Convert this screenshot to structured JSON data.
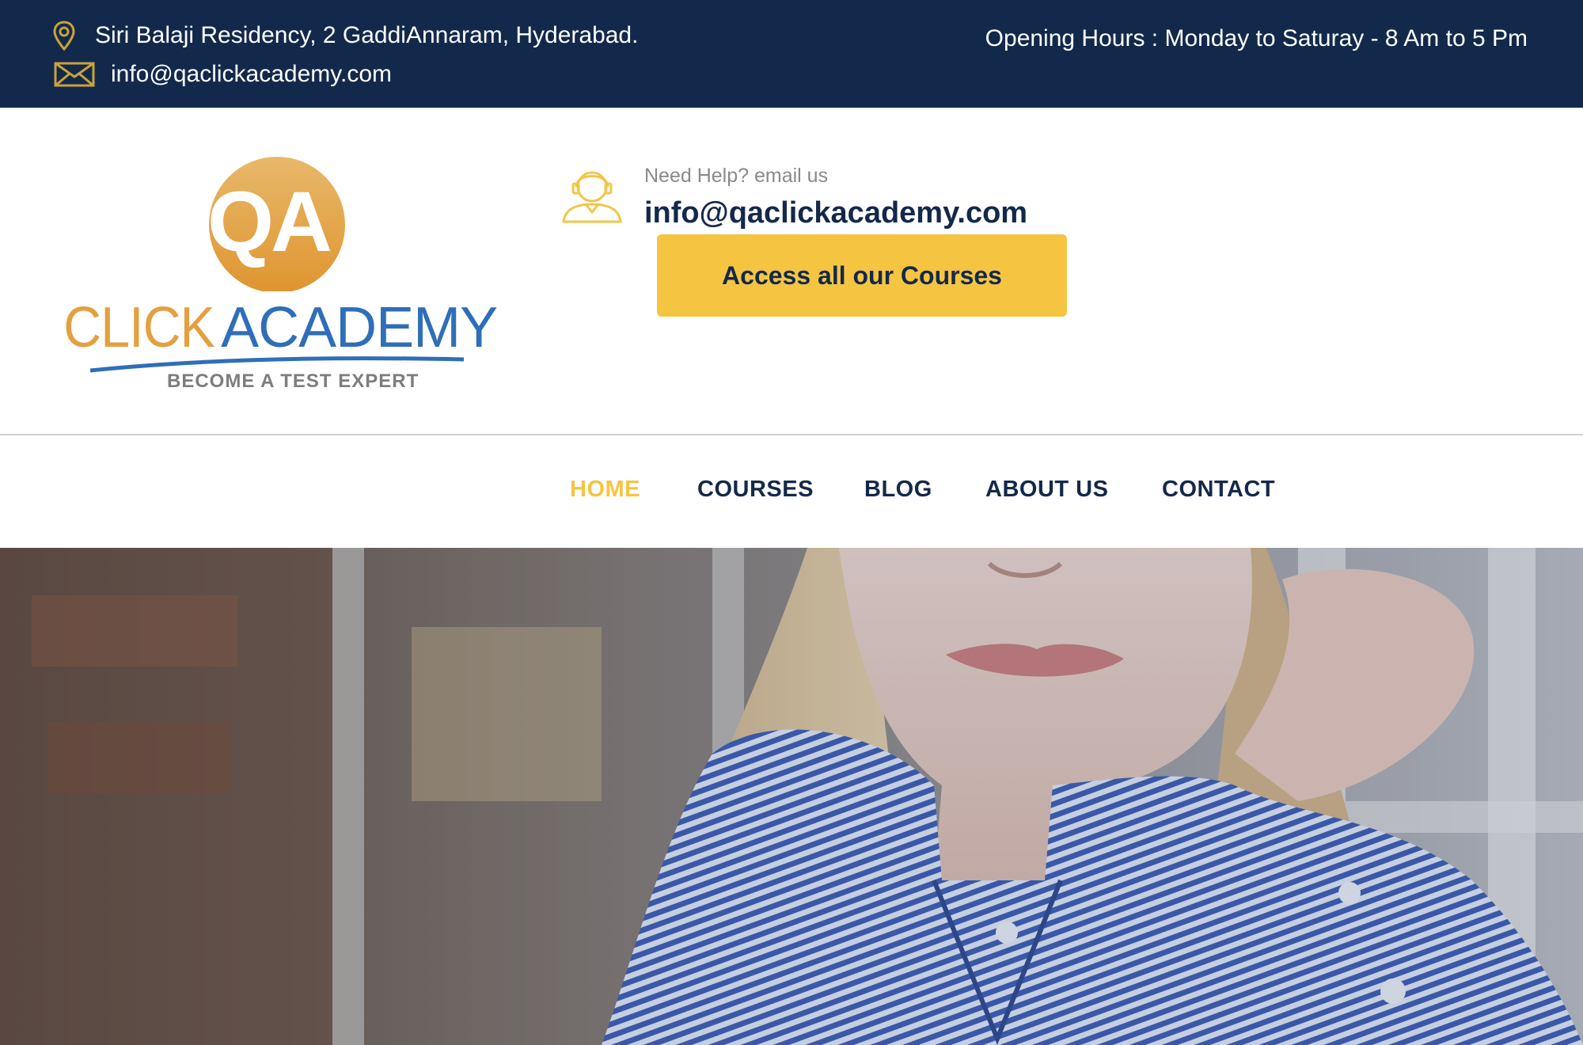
{
  "topbar": {
    "address": "Siri Balaji Residency, 2 GaddiAnnaram, Hyderabad.",
    "email": "info@qaclickacademy.com",
    "hours": "Opening Hours : Monday to Saturay - 8 Am to 5 Pm",
    "address_icon": "map-pin-icon",
    "email_icon": "envelope-icon"
  },
  "logo": {
    "mark": "QA",
    "word_left": "CLICK",
    "word_right": "ACADEMY",
    "tagline": "BECOME A TEST EXPERT"
  },
  "help": {
    "icon": "support-agent-icon",
    "label": "Need Help? email us",
    "email": "info@qaclickacademy.com",
    "cta_label": "Access all our Courses"
  },
  "nav": {
    "items": [
      {
        "label": "HOME",
        "active": true
      },
      {
        "label": "COURSES",
        "active": false
      },
      {
        "label": "BLOG",
        "active": false
      },
      {
        "label": "ABOUT US",
        "active": false
      },
      {
        "label": "CONTACT",
        "active": false
      }
    ]
  },
  "colors": {
    "navy": "#13294b",
    "accent_yellow": "#f5c542",
    "logo_orange": "#e4a040",
    "logo_blue": "#2f6eb9",
    "shirt_blue": "#4a6cc0"
  }
}
